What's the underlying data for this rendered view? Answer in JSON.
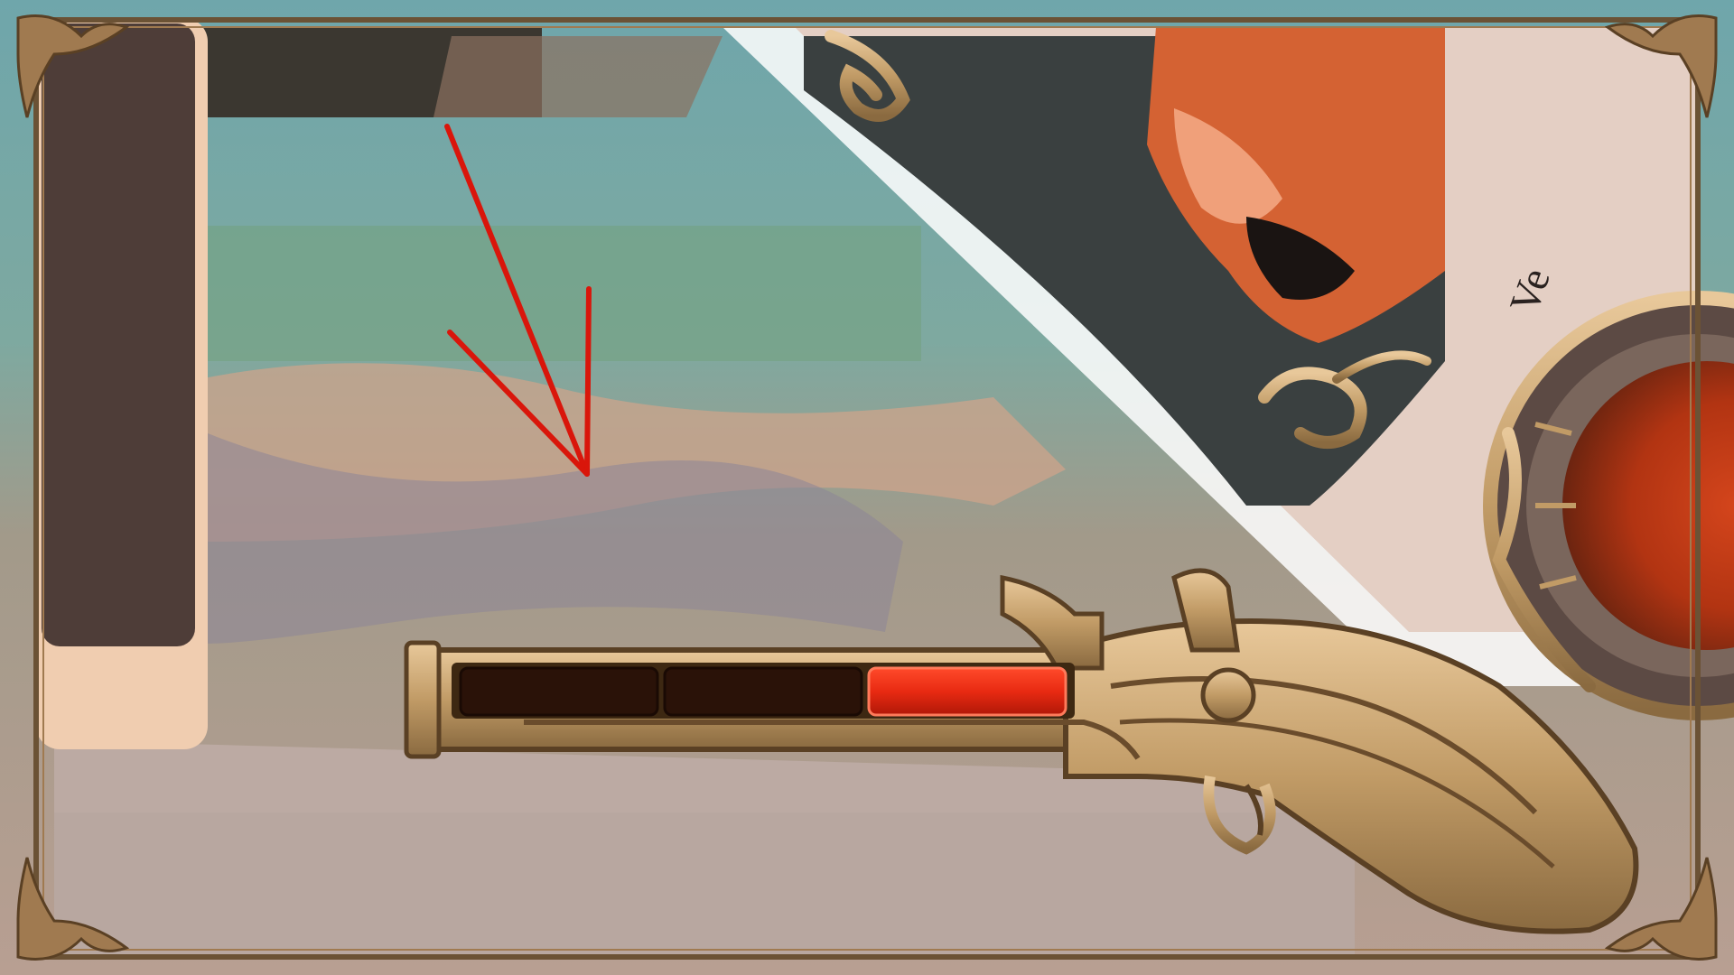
{
  "screen": {
    "type": "game-hud-zoom",
    "description_free": true
  },
  "ammo_gauge": {
    "icon": "flintlock-pistol-icon",
    "segments_total": 3,
    "segments_filled": 1,
    "fill_color": "#e82a12",
    "empty_color": "#2a1208"
  },
  "card": {
    "caption_fragment": "Ve"
  },
  "annotation": {
    "icon": "red-arrow-icon",
    "color": "#d9160b"
  },
  "frame": {
    "style": "ornate-bronze",
    "color": "#a07a50"
  }
}
